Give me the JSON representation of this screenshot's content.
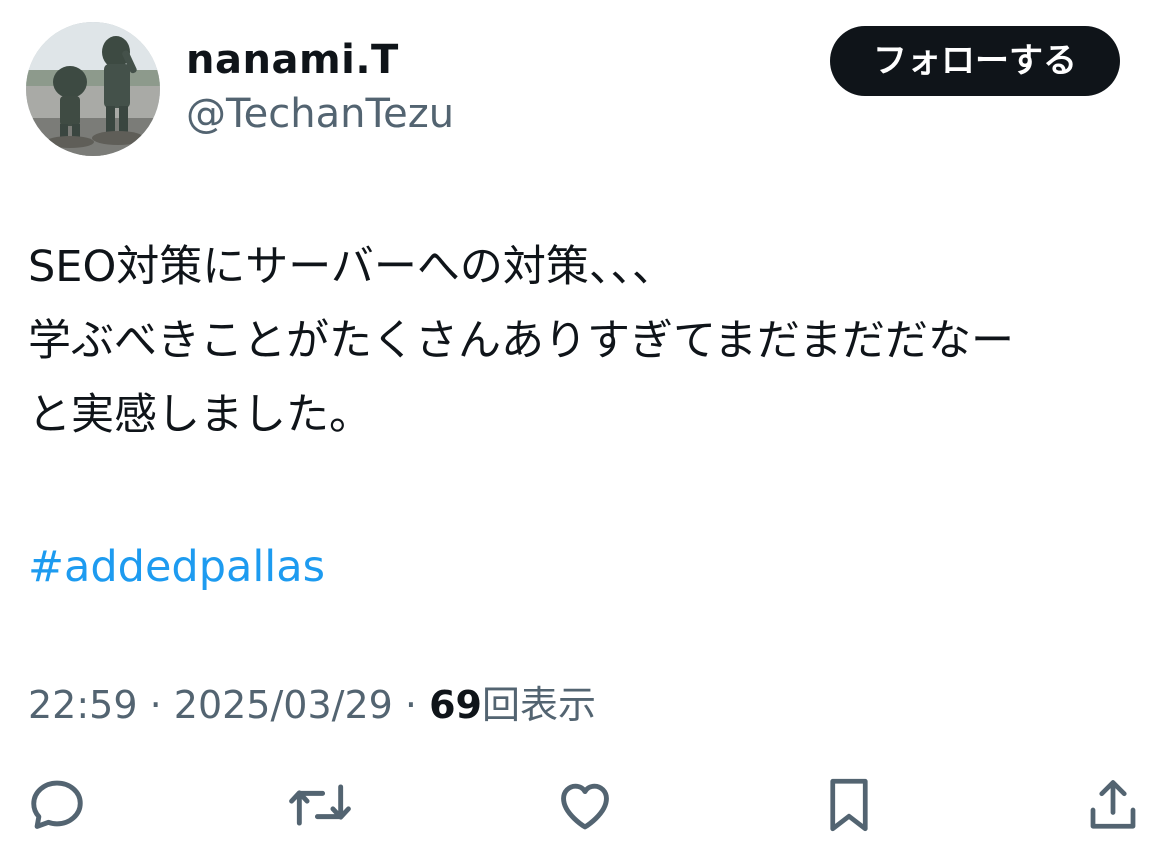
{
  "user": {
    "display_name": "nanami.T",
    "handle": "@TechanTezu",
    "avatar_icon": "profile-photo"
  },
  "follow_button": {
    "label": "フォローする"
  },
  "tweet": {
    "lines": [
      "SEO対策にサーバーへの対策、、、",
      "学ぶべきことがたくさんありすぎてまだまだだなー",
      "と実感しました。"
    ],
    "hashtag": "#addedpallas"
  },
  "meta": {
    "time": "22:59",
    "separator": "·",
    "date": "2025/03/29",
    "views_count": "69",
    "views_label": "回表示"
  },
  "actions": [
    {
      "name": "reply-icon"
    },
    {
      "name": "retweet-icon"
    },
    {
      "name": "like-icon"
    },
    {
      "name": "bookmark-icon"
    },
    {
      "name": "share-icon"
    }
  ],
  "colors": {
    "text": "#0f1419",
    "secondary": "#536471",
    "link": "#1d9bf0",
    "button_bg": "#0f1419"
  }
}
